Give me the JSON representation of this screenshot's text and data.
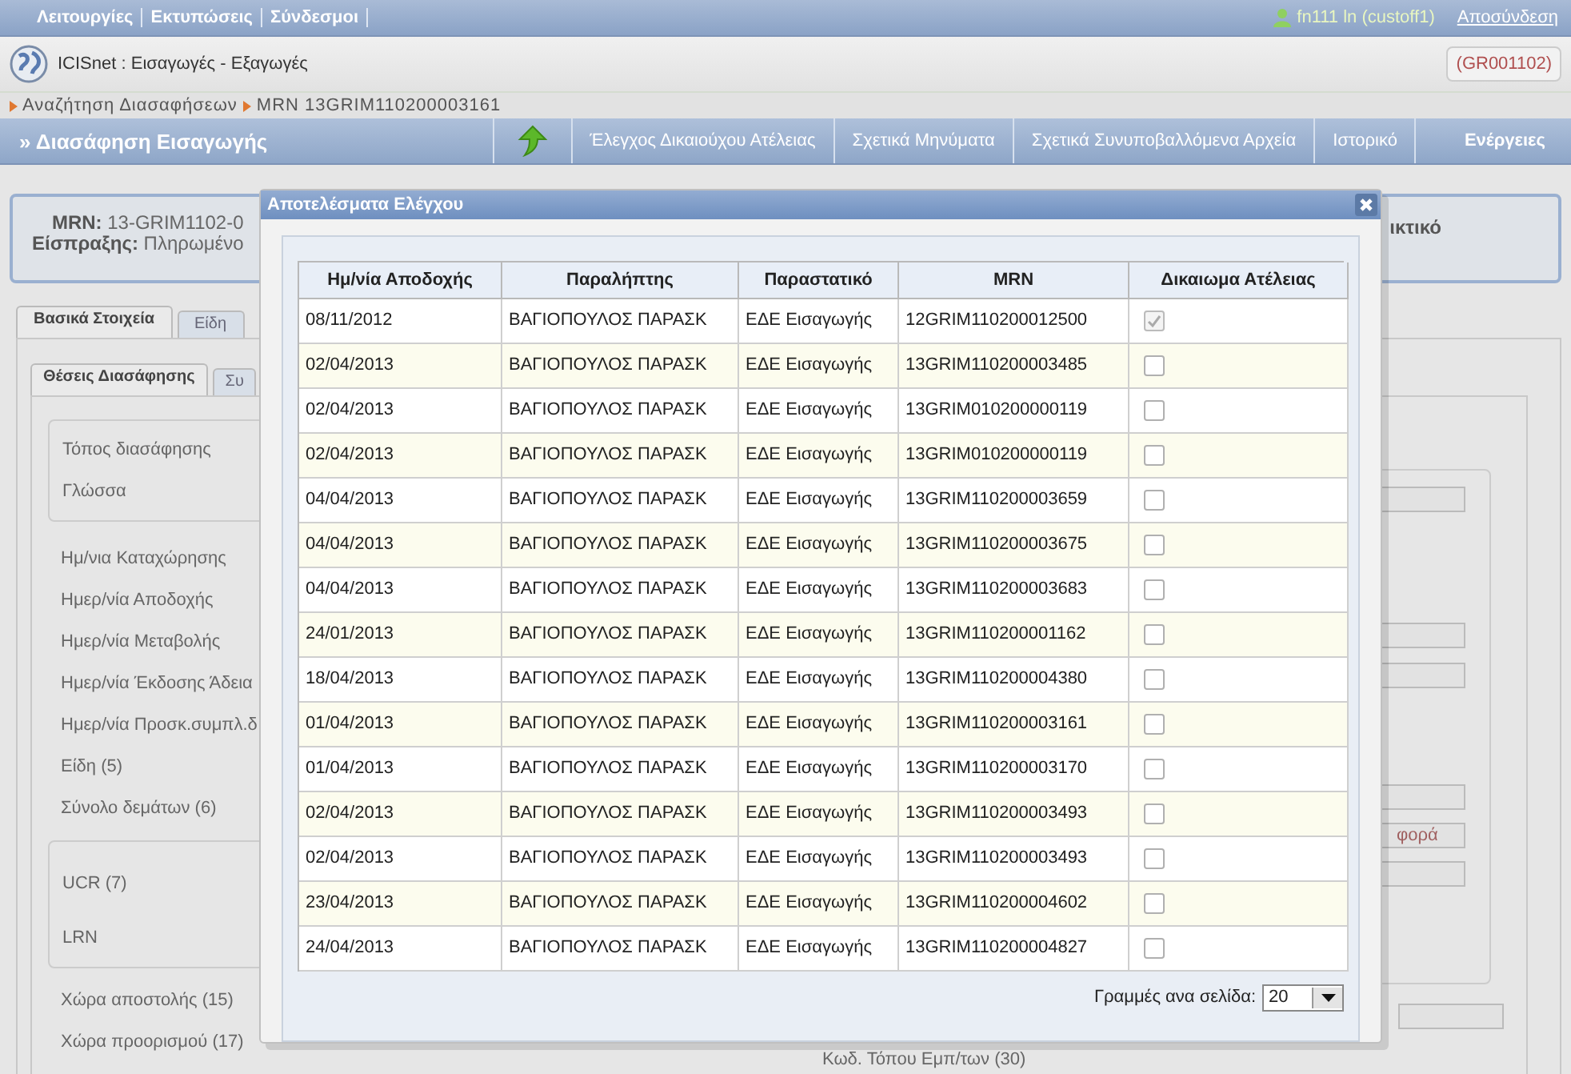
{
  "menu": [
    "Λειτουργίες",
    "Εκτυπώσεις",
    "Σύνδεσμοι"
  ],
  "user": "fn111 ln (custoff1)",
  "logout": "Αποσύνδεση",
  "app_title": "ICISnet : Εισαγωγές - Εξαγωγές",
  "office_code": "(GR001102)",
  "breadcrumb": [
    "Αναζήτηση Διασαφήσεων",
    "MRN 13GRIM110200003161"
  ],
  "page_title": "» Διασάφηση Εισαγωγής",
  "nav_items": [
    "Έλεγχος Δικαιούχου Ατέλειας",
    "Σχετικά Μηνύματα",
    "Σχετικά Συνυποβαλλόμενα Αρχεία",
    "Ιστορικό",
    "Ενέργειες"
  ],
  "summary": {
    "mrn_label": "MRN:",
    "mrn_value": "13-GRIM1102-0",
    "receipt_label": "Είσπραξης:",
    "receipt_value": "Πληρωμένο",
    "right_fragment": "ικτικό"
  },
  "tabs": [
    {
      "label": "Βασικά Στοιχεία",
      "selected": true
    },
    {
      "label": "Είδη",
      "selected": false
    }
  ],
  "subtabs": [
    {
      "label": "Θέσεις Διασάφησης",
      "selected": true
    },
    {
      "label": "Συ",
      "selected": false
    }
  ],
  "group_1": [
    "Τόπος διασάφησης",
    "Γλώσσα"
  ],
  "fields_1": [
    "Ημ/νια Καταχώρησης",
    "Ημερ/νία Αποδοχής",
    "Ημερ/νία Μεταβολής",
    "Ημερ/νία Έκδοσης Άδεια",
    "Ημερ/νία Προσκ.συμπλ.δ",
    "Είδη (5)",
    "Σύνολο δεμάτων (6)"
  ],
  "group_2": [
    "UCR (7)",
    "LRN"
  ],
  "fields_2": [
    "Χώρα αποστολής (15)",
    "Χώρα προορισμού (17)"
  ],
  "right_field_value": "φορά",
  "bottom_field": "Κωδ. Τόπου Εμπ/των (30)",
  "dialog": {
    "title": "Αποτελέσματα Ελέγχου",
    "columns": [
      "Ημ/νία Αποδοχής",
      "Παραλήπτης",
      "Παραστατικό",
      "MRN",
      "Δικαιωμα Ατέλειας"
    ],
    "rows": [
      {
        "date": "08/11/2012",
        "consignee": "ΒΑΓΙΟΠΟΥΛΟΣ ΠΑΡΑΣΚ",
        "document": "ΕΔΕ Εισαγωγής",
        "mrn": "12GRIM110200012500",
        "checked": true
      },
      {
        "date": "02/04/2013",
        "consignee": "ΒΑΓΙΟΠΟΥΛΟΣ ΠΑΡΑΣΚ",
        "document": "ΕΔΕ Εισαγωγής",
        "mrn": "13GRIM110200003485",
        "checked": false
      },
      {
        "date": "02/04/2013",
        "consignee": "ΒΑΓΙΟΠΟΥΛΟΣ ΠΑΡΑΣΚ",
        "document": "ΕΔΕ Εισαγωγής",
        "mrn": "13GRIM010200000119",
        "checked": false
      },
      {
        "date": "02/04/2013",
        "consignee": "ΒΑΓΙΟΠΟΥΛΟΣ ΠΑΡΑΣΚ",
        "document": "ΕΔΕ Εισαγωγής",
        "mrn": "13GRIM010200000119",
        "checked": false
      },
      {
        "date": "04/04/2013",
        "consignee": "ΒΑΓΙΟΠΟΥΛΟΣ ΠΑΡΑΣΚ",
        "document": "ΕΔΕ Εισαγωγής",
        "mrn": "13GRIM110200003659",
        "checked": false
      },
      {
        "date": "04/04/2013",
        "consignee": "ΒΑΓΙΟΠΟΥΛΟΣ ΠΑΡΑΣΚ",
        "document": "ΕΔΕ Εισαγωγής",
        "mrn": "13GRIM110200003675",
        "checked": false
      },
      {
        "date": "04/04/2013",
        "consignee": "ΒΑΓΙΟΠΟΥΛΟΣ ΠΑΡΑΣΚ",
        "document": "ΕΔΕ Εισαγωγής",
        "mrn": "13GRIM110200003683",
        "checked": false
      },
      {
        "date": "24/01/2013",
        "consignee": "ΒΑΓΙΟΠΟΥΛΟΣ ΠΑΡΑΣΚ",
        "document": "ΕΔΕ Εισαγωγής",
        "mrn": "13GRIM110200001162",
        "checked": false
      },
      {
        "date": "18/04/2013",
        "consignee": "ΒΑΓΙΟΠΟΥΛΟΣ ΠΑΡΑΣΚ",
        "document": "ΕΔΕ Εισαγωγής",
        "mrn": "13GRIM110200004380",
        "checked": false
      },
      {
        "date": "01/04/2013",
        "consignee": "ΒΑΓΙΟΠΟΥΛΟΣ ΠΑΡΑΣΚ",
        "document": "ΕΔΕ Εισαγωγής",
        "mrn": "13GRIM110200003161",
        "checked": false
      },
      {
        "date": "01/04/2013",
        "consignee": "ΒΑΓΙΟΠΟΥΛΟΣ ΠΑΡΑΣΚ",
        "document": "ΕΔΕ Εισαγωγής",
        "mrn": "13GRIM110200003170",
        "checked": false
      },
      {
        "date": "02/04/2013",
        "consignee": "ΒΑΓΙΟΠΟΥΛΟΣ ΠΑΡΑΣΚ",
        "document": "ΕΔΕ Εισαγωγής",
        "mrn": "13GRIM110200003493",
        "checked": false
      },
      {
        "date": "02/04/2013",
        "consignee": "ΒΑΓΙΟΠΟΥΛΟΣ ΠΑΡΑΣΚ",
        "document": "ΕΔΕ Εισαγωγής",
        "mrn": "13GRIM110200003493",
        "checked": false
      },
      {
        "date": "23/04/2013",
        "consignee": "ΒΑΓΙΟΠΟΥΛΟΣ ΠΑΡΑΣΚ",
        "document": "ΕΔΕ Εισαγωγής",
        "mrn": "13GRIM110200004602",
        "checked": false
      },
      {
        "date": "24/04/2013",
        "consignee": "ΒΑΓΙΟΠΟΥΛΟΣ ΠΑΡΑΣΚ",
        "document": "ΕΔΕ Εισαγωγής",
        "mrn": "13GRIM110200004827",
        "checked": false
      }
    ],
    "page_size_label": "Γραμμές ανα σελίδα:",
    "page_size": "20"
  }
}
